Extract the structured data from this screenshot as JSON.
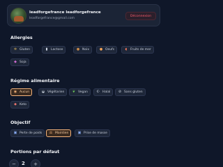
{
  "profile": {
    "name": "leadforgefrance leadforgefrance",
    "email": "leadforgefrance@gmail.com",
    "logout_label": "Déconnexion"
  },
  "allergies": {
    "title": "Allergies",
    "items": [
      {
        "label": "Gluten",
        "icon": "wheat-icon",
        "active": false
      },
      {
        "label": "Lactose",
        "icon": "milk-icon",
        "active": false
      },
      {
        "label": "Noix",
        "icon": "nut-icon",
        "active": false
      },
      {
        "label": "Oeufs",
        "icon": "egg-icon",
        "active": false
      },
      {
        "label": "Fruits de mer",
        "icon": "shrimp-icon",
        "active": false
      },
      {
        "label": "Soja",
        "icon": "soy-icon",
        "active": false
      }
    ]
  },
  "diet": {
    "title": "Régime alimentaire",
    "items": [
      {
        "label": "Aucun",
        "icon": "plate-icon",
        "active": true
      },
      {
        "label": "Végétarien",
        "icon": "salad-icon",
        "active": false
      },
      {
        "label": "Vegan",
        "icon": "leaf-icon",
        "active": false
      },
      {
        "label": "Halal",
        "icon": "halal-icon",
        "active": false
      },
      {
        "label": "Sans gluten",
        "icon": "no-wheat-icon",
        "active": false
      },
      {
        "label": "Keto",
        "icon": "keto-icon",
        "active": false
      }
    ]
  },
  "objective": {
    "title": "Objectif",
    "items": [
      {
        "label": "Perte de poids",
        "icon": "scale-icon",
        "active": false
      },
      {
        "label": "Maintien",
        "icon": "balance-icon",
        "active": true
      },
      {
        "label": "Prise de masse",
        "icon": "muscle-icon",
        "active": false
      }
    ]
  },
  "portions": {
    "title": "Portions par défaut",
    "value": "2",
    "minus": "−",
    "plus": "+"
  }
}
